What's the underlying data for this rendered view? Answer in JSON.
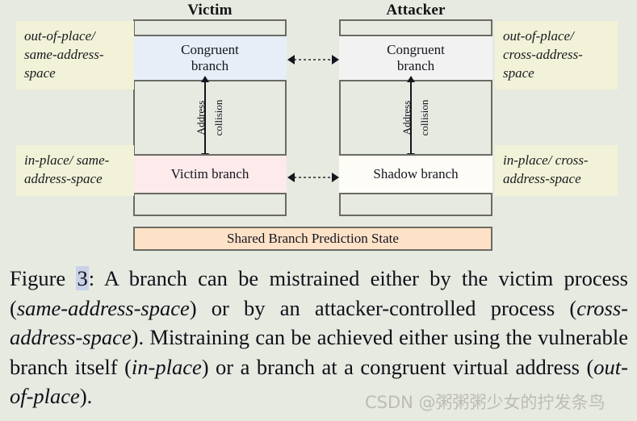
{
  "figure": {
    "columns": [
      {
        "heading": "Victim",
        "congruent_branch_label": "Congruent\nbranch",
        "target_branch_label": "Victim branch",
        "collision_label_line1": "Address",
        "collision_label_line2": "collision",
        "congruent_fill": "#e7eef8",
        "target_fill": "#fdeaea"
      },
      {
        "heading": "Attacker",
        "congruent_branch_label": "Congruent\nbranch",
        "target_branch_label": "Shadow branch",
        "collision_label_line1": "Address",
        "collision_label_line2": "collision",
        "congruent_fill": "#f2f2f2",
        "target_fill": "#fdfcf7"
      }
    ],
    "annotations": {
      "top_left": "out-of-place/ same-address-space",
      "bottom_left": "in-place/ same-address-space",
      "top_right": "out-of-place/ cross-address-space",
      "bottom_right": "in-place/ cross-address-space"
    },
    "shared_state_label": "Shared Branch Prediction State",
    "colors": {
      "page_background": "#e6eae1",
      "annotation_background": "#f2f2d8",
      "shared_state_background": "#fde2c8",
      "border": "#6b6b63",
      "caption_highlight": "#c9d2e8"
    }
  },
  "caption": {
    "prefix": "Figure ",
    "number": "3",
    "text_1": ": A branch can be mistrained either by the victim process (",
    "italic_1": "same-address-space",
    "text_2": ") or by an attacker-controlled process (",
    "italic_2": "cross-address-space",
    "text_3": "). Mistraining can be achieved either using the vulnerable branch itself (",
    "italic_3": "in-place",
    "text_4": ") or a branch at a congruent virtual address (",
    "italic_4": "out-of-place",
    "text_5": ")."
  },
  "watermark": {
    "text": "CSDN @粥粥粥少女的拧发条鸟"
  }
}
